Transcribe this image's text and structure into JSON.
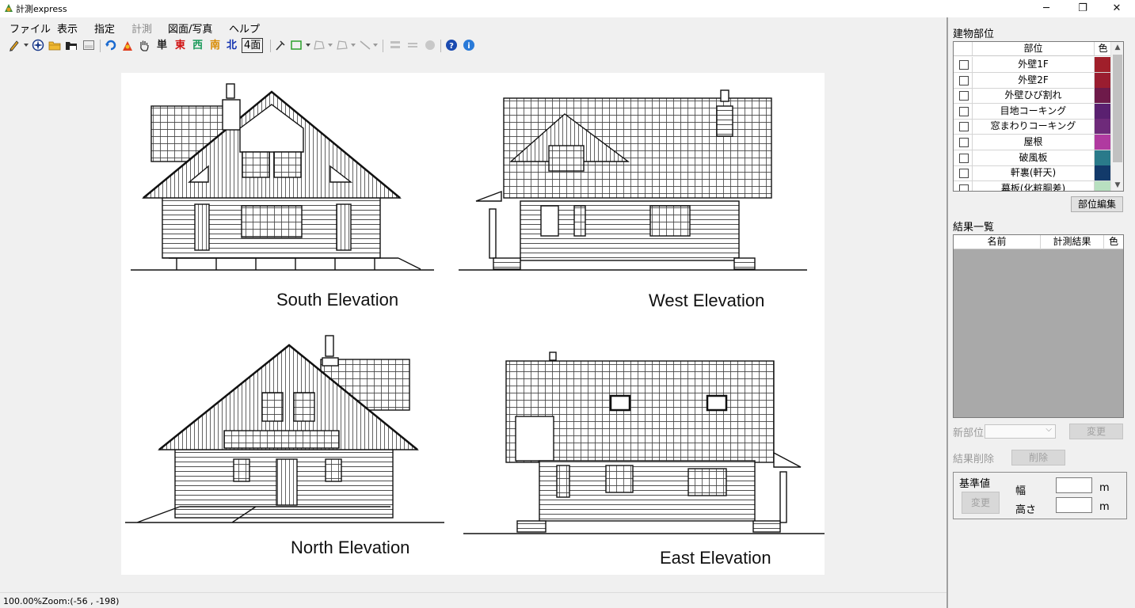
{
  "window": {
    "title": "計測express",
    "controls": {
      "minimize": "─",
      "restore": "❐",
      "close": "✕"
    }
  },
  "menu": [
    {
      "label": "ファイル",
      "enabled": true
    },
    {
      "label": "表示",
      "enabled": true
    },
    {
      "label": "指定",
      "enabled": true
    },
    {
      "label": "計測",
      "enabled": false
    },
    {
      "label": "図面/写真",
      "enabled": true
    },
    {
      "label": "ヘルプ",
      "enabled": true
    }
  ],
  "toolbar": {
    "direction_buttons": [
      "単",
      "東",
      "西",
      "南",
      "北",
      "4面"
    ],
    "direction_colors": [
      "#222222",
      "#d01010",
      "#1a9a5a",
      "#d88a00",
      "#1030b0",
      "#222222"
    ]
  },
  "drawing": {
    "labels": {
      "south": "South Elevation",
      "west": "West Elevation",
      "north": "North Elevation",
      "east": "East Elevation"
    }
  },
  "status": {
    "zoom_percent": "100.00%",
    "zoom_info": "Zoom:(-56 , -198)"
  },
  "panel": {
    "parts_title": "建物部位",
    "parts_columns": {
      "part": "部位",
      "color": "色"
    },
    "parts": [
      {
        "name": "外壁1F",
        "color": "#a01f2a"
      },
      {
        "name": "外壁2F",
        "color": "#9a1d30"
      },
      {
        "name": "外壁ひび割れ",
        "color": "#6e1a4a"
      },
      {
        "name": "目地コーキング",
        "color": "#5a2070"
      },
      {
        "name": "窓まわりコーキング",
        "color": "#6e2a7a"
      },
      {
        "name": "屋根",
        "color": "#b03aa0"
      },
      {
        "name": "破風板",
        "color": "#2a7a8a"
      },
      {
        "name": "軒裏(軒天)",
        "color": "#123a6a"
      },
      {
        "name": "幕板(化粧胴差)",
        "color": "#b8e0c0"
      }
    ],
    "edit_parts_button": "部位編集",
    "results_title": "結果一覧",
    "results_columns": {
      "name": "名前",
      "result": "計測結果",
      "color": "色"
    },
    "new_part_label": "新部位",
    "change_button": "変更",
    "delete_result_label": "結果削除",
    "delete_button": "削除",
    "reference": {
      "title": "基準値",
      "change_button": "変更",
      "width_label": "幅",
      "height_label": "高さ",
      "unit": "m"
    }
  }
}
